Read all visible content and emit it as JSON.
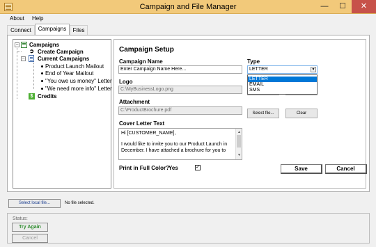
{
  "window": {
    "title": "Campaign and File Manager",
    "minimize": "—",
    "maximize": "☐",
    "close": "✕"
  },
  "menu": [
    "About",
    "Help"
  ],
  "tabs": [
    "Connect",
    "Campaigns",
    "Files"
  ],
  "tree": {
    "root": "Campaigns",
    "create": "Create Campaign",
    "current": "Current Campaigns",
    "items": [
      "Product Launch Mailout",
      "End of Year Mailout",
      "\"You owe us money\" Letter",
      "\"We need more info\" Letter"
    ],
    "credits": "Credits"
  },
  "setup": {
    "heading": "Campaign Setup",
    "campaign_name_label": "Campaign Name",
    "campaign_name_value": "Enter Campaign Name Here...",
    "type_label": "Type",
    "type_selected": "LETTER",
    "type_options": [
      "LETTER",
      "EMAIL",
      "SMS"
    ],
    "logo_label": "Logo",
    "logo_value": "C:\\MyBusinessLogo.png",
    "attachment_label": "Attachment",
    "attachment_value": "C:\\ProductBrochure.pdf",
    "select_file": "Select file...",
    "clear": "Clear",
    "cover_label": "Cover Letter Text",
    "cover_line1": "Hi [CUSTOMER_NAME],",
    "cover_line2": "I would like to invite you to our Product Launch in December. I have attached a brochure for you to",
    "print_label": "Print in Full Color?",
    "print_value": "Yes",
    "print_checked": "✓",
    "save": "Save",
    "cancel": "Cancel"
  },
  "bottom": {
    "select_local": "Select local file...",
    "no_file": "No file selected."
  },
  "status": {
    "label": "Status:",
    "try_again": "Try Again",
    "cancel": "Cancel"
  },
  "colors": {
    "titlebar": "#f2c97a",
    "close": "#c7524a",
    "try_again": "#2e8b2e",
    "select_accent": "#0078d7"
  }
}
